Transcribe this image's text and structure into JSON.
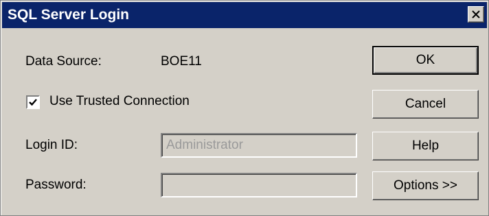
{
  "window": {
    "title": "SQL Server Login",
    "close_icon": "close-icon"
  },
  "colors": {
    "titlebar": "#0a246a",
    "dialog_face": "#d4d0c8",
    "disabled_text": "#9a9a9a"
  },
  "form": {
    "data_source_label": "Data Source:",
    "data_source_value": "BOE11",
    "trusted_connection_label": "Use Trusted Connection",
    "trusted_connection_checked": true,
    "login_id_label": "Login ID:",
    "login_id_value": "Administrator",
    "password_label": "Password:",
    "password_value": ""
  },
  "buttons": {
    "ok": "OK",
    "cancel": "Cancel",
    "help": "Help",
    "options": "Options >>"
  }
}
